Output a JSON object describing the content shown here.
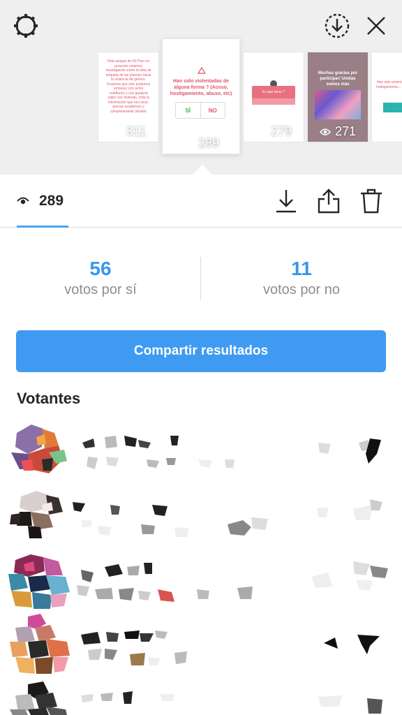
{
  "header": {
    "icons": [
      "gear-icon",
      "download-circle-icon",
      "close-icon"
    ]
  },
  "stories": [
    {
      "views": "311",
      "text": "Hola amigas de XII Paro en proyecto estamos investigando sobre la falta de empatía de las jóvenes hacia la violencia de género. Creemos que sólo podemos empezar con actos cotidianos y nos gustaría saber sus historias, toda la información que nos sirve; gracias académico y completamente privado"
    },
    {
      "views": "289",
      "question": "Han sido violentadas de alguna forma ? (Acoso, hostigamiento, abuso, etc)",
      "option_yes": "SÍ",
      "option_no": "NO"
    },
    {
      "views": "279",
      "text": "Es que tema ?"
    },
    {
      "views": "271",
      "text": "Muchas gracias por participar! Unidas somos más"
    },
    {
      "views": "",
      "text": "Han sido violentadas de alguna forma ? hostigamiento... Lo sentimos amigas !! A"
    }
  ],
  "viewer_bar": {
    "count": "289",
    "icons": [
      "eye-icon",
      "download-icon",
      "share-icon",
      "trash-icon"
    ]
  },
  "poll": {
    "yes_count": "56",
    "yes_label": "votos por sí",
    "no_count": "11",
    "no_label": "votos por no"
  },
  "share_button": "Compartir resultados",
  "voters_title": "Votantes",
  "colors": {
    "accent": "#3897f0",
    "button": "#3f9af2",
    "story_text": "#e0566a"
  }
}
